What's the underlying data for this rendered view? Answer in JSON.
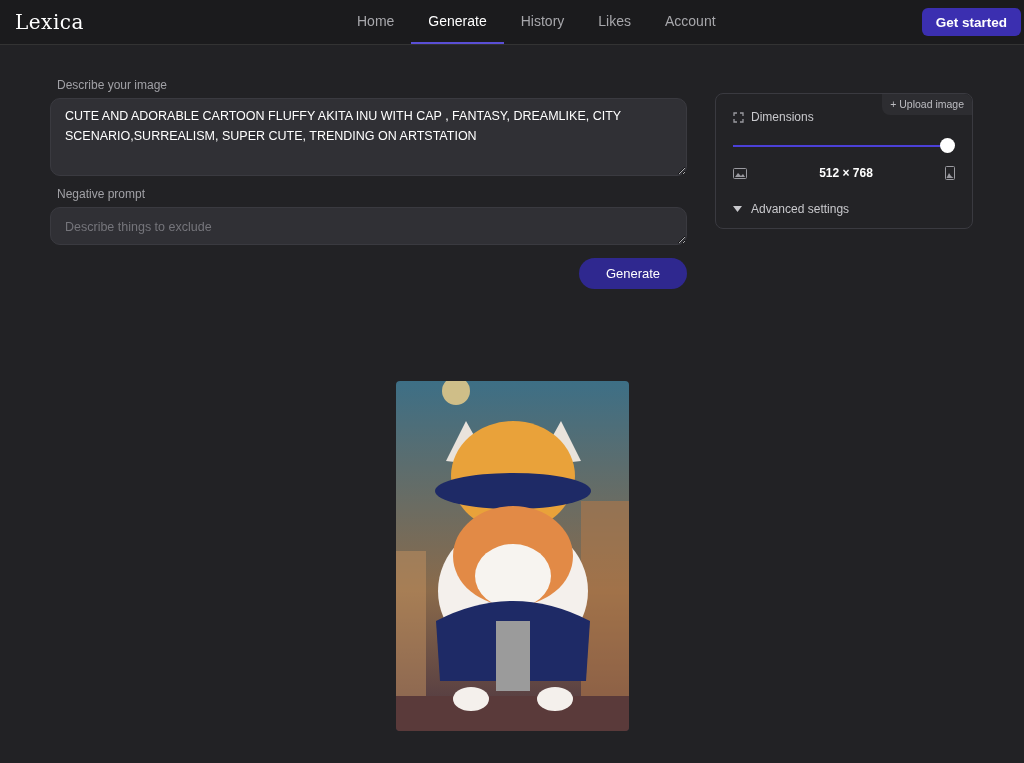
{
  "header": {
    "logo": "Lexica",
    "nav": [
      {
        "label": "Home",
        "selected": false
      },
      {
        "label": "Generate",
        "selected": true
      },
      {
        "label": "History",
        "selected": false
      },
      {
        "label": "Likes",
        "selected": false
      },
      {
        "label": "Account",
        "selected": false
      }
    ],
    "cta": "Get started"
  },
  "prompt": {
    "label": "Describe your image",
    "value": "CUTE AND ADORABLE CARTOON FLUFFY AKITA INU WITH CAP , FANTASY, DREAMLIKE, CITY SCENARIO,SURREALISM, SUPER CUTE, TRENDING ON ARTSTATION"
  },
  "negative": {
    "label": "Negative prompt",
    "placeholder": "Describe things to exclude"
  },
  "generate_button": "Generate",
  "settings": {
    "upload": "+ Upload image",
    "dimensions_label": "Dimensions",
    "slider": {
      "level": 1
    },
    "size": "512 × 768",
    "advanced": "Advanced settings"
  }
}
